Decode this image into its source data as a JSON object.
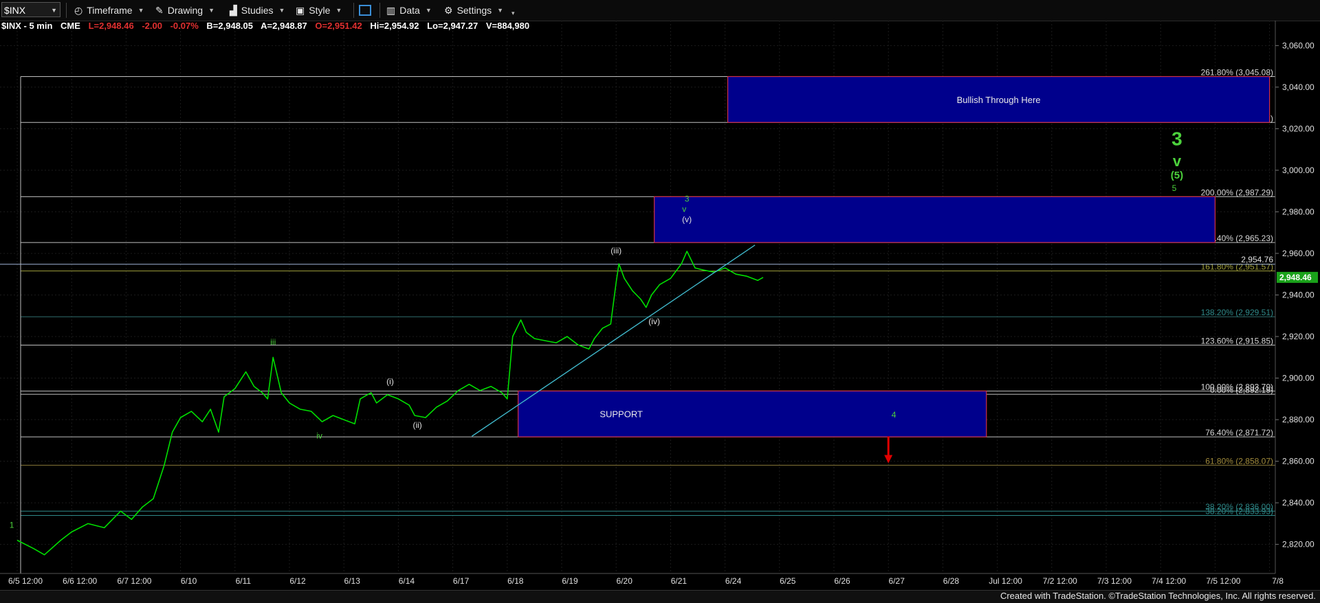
{
  "toolbar": {
    "symbol": "$INX",
    "timeframe": "Timeframe",
    "drawing": "Drawing",
    "studies": "Studies",
    "style": "Style",
    "data": "Data",
    "settings": "Settings"
  },
  "quote": {
    "symbol_interval": "$INX - 5 min",
    "exchange": "CME",
    "last": "L=2,948.46",
    "change": "-2.00",
    "pct": "-0.07%",
    "bid": "B=2,948.05",
    "ask": "A=2,948.87",
    "open": "O=2,951.42",
    "high": "Hi=2,954.92",
    "low": "Lo=2,947.27",
    "volume": "V=884,980"
  },
  "footer": "Created with TradeStation. ©TradeStation Technologies, Inc. All rights reserved.",
  "colors": {
    "background": "#000000",
    "price": "#00e000",
    "box_fill": "#00008c",
    "box_border": "#d0304a",
    "trendline": "#3fb6c9",
    "grid": "#1c1c1c",
    "down_arrow": "#e00000"
  },
  "chart_data": {
    "type": "line",
    "title": "",
    "ylim": [
      2806,
      3072
    ],
    "y_ticks": [
      "3,060.00",
      "3,040.00",
      "3,020.00",
      "3,000.00",
      "2,980.00",
      "2,960.00",
      "2,940.00",
      "2,920.00",
      "2,900.00",
      "2,880.00",
      "2,860.00",
      "2,840.00",
      "2,820.00"
    ],
    "y_tick_values": [
      3060,
      3040,
      3020,
      3000,
      2980,
      2960,
      2940,
      2920,
      2900,
      2880,
      2860,
      2840,
      2820
    ],
    "x_ticks": [
      "6/5 12:00",
      "6/6 12:00",
      "6/7 12:00",
      "6/10",
      "6/11",
      "6/12",
      "6/13",
      "6/14",
      "6/17",
      "6/18",
      "6/19",
      "6/20",
      "6/21",
      "6/24",
      "6/25",
      "6/26",
      "6/27",
      "6/28",
      "Jul 12:00",
      "7/2 12:00",
      "7/3 12:00",
      "7/4 12:00",
      "7/5 12:00",
      "7/8"
    ],
    "last_price": "2,948.46",
    "session_high": "2,954.76",
    "series": [
      {
        "values": [
          [
            0,
            2822
          ],
          [
            0.3,
            2818
          ],
          [
            0.5,
            2815
          ],
          [
            0.8,
            2822
          ],
          [
            1.0,
            2826
          ],
          [
            1.3,
            2830
          ],
          [
            1.6,
            2828
          ],
          [
            1.9,
            2836
          ],
          [
            2.1,
            2832
          ],
          [
            2.3,
            2838
          ],
          [
            2.5,
            2842
          ],
          [
            2.7,
            2858
          ],
          [
            2.85,
            2874
          ],
          [
            3.0,
            2881
          ],
          [
            3.2,
            2884
          ],
          [
            3.4,
            2879
          ],
          [
            3.55,
            2885
          ],
          [
            3.7,
            2874
          ],
          [
            3.8,
            2891
          ],
          [
            4.0,
            2895
          ],
          [
            4.2,
            2903
          ],
          [
            4.35,
            2896
          ],
          [
            4.5,
            2893
          ],
          [
            4.6,
            2890
          ],
          [
            4.7,
            2910
          ],
          [
            4.85,
            2893
          ],
          [
            5.0,
            2888
          ],
          [
            5.2,
            2885
          ],
          [
            5.4,
            2884
          ],
          [
            5.6,
            2879
          ],
          [
            5.8,
            2882
          ],
          [
            6.0,
            2880
          ],
          [
            6.2,
            2878
          ],
          [
            6.3,
            2890
          ],
          [
            6.5,
            2893
          ],
          [
            6.6,
            2888
          ],
          [
            6.8,
            2892
          ],
          [
            7.0,
            2890
          ],
          [
            7.2,
            2887
          ],
          [
            7.3,
            2882
          ],
          [
            7.5,
            2881
          ],
          [
            7.7,
            2886
          ],
          [
            7.9,
            2889
          ],
          [
            8.1,
            2894
          ],
          [
            8.3,
            2897
          ],
          [
            8.5,
            2894
          ],
          [
            8.7,
            2896
          ],
          [
            8.9,
            2893
          ],
          [
            9.0,
            2890
          ],
          [
            9.05,
            2905
          ],
          [
            9.1,
            2920
          ],
          [
            9.25,
            2928
          ],
          [
            9.35,
            2922
          ],
          [
            9.5,
            2919
          ],
          [
            9.7,
            2918
          ],
          [
            9.9,
            2917
          ],
          [
            10.1,
            2920
          ],
          [
            10.3,
            2916
          ],
          [
            10.5,
            2914
          ],
          [
            10.6,
            2919
          ],
          [
            10.75,
            2924
          ],
          [
            10.9,
            2926
          ],
          [
            10.95,
            2936
          ],
          [
            11.0,
            2946
          ],
          [
            11.05,
            2955
          ],
          [
            11.15,
            2948
          ],
          [
            11.3,
            2942
          ],
          [
            11.45,
            2938
          ],
          [
            11.55,
            2934
          ],
          [
            11.65,
            2940
          ],
          [
            11.8,
            2945
          ],
          [
            12.0,
            2948
          ],
          [
            12.2,
            2955
          ],
          [
            12.3,
            2961
          ],
          [
            12.45,
            2953
          ],
          [
            12.6,
            2952
          ],
          [
            12.8,
            2951
          ],
          [
            13.0,
            2953
          ],
          [
            13.2,
            2950
          ],
          [
            13.4,
            2949
          ],
          [
            13.6,
            2947
          ],
          [
            13.7,
            2948.46
          ]
        ]
      }
    ],
    "fib_levels": [
      {
        "label": "261.80% (3,045.08)",
        "value": 3045.08
      },
      {
        "label": "238.20% (3,023.01)",
        "value": 3023.01
      },
      {
        "label": "200.00% (2,987.29)",
        "value": 2987.29
      },
      {
        "label": "176.40% (2,965.23)",
        "value": 2965.23
      },
      {
        "label": "161.80% (2,951.57)",
        "value": 2951.57
      },
      {
        "label": "138.20% (2,929.51)",
        "value": 2929.51
      },
      {
        "label": "123.60% (2,915.85)",
        "value": 2915.85
      },
      {
        "label": "100.00% (2,893.79)",
        "value": 2893.79
      },
      {
        "label": "0.00% (2,892.19)",
        "value": 2892.19
      },
      {
        "label": "76.40% (2,871.72)",
        "value": 2871.72
      },
      {
        "label": "61.80% (2,858.07)",
        "value": 2858.07
      },
      {
        "label": "38.20% (2,836.00)",
        "value": 2836.0
      },
      {
        "label": "38.20% (2,833.93)",
        "value": 2833.93
      }
    ],
    "zones": [
      {
        "label": "Bullish Through Here",
        "x0": 13.05,
        "x1": 23.0,
        "y0": 3023.01,
        "y1": 3045.08
      },
      {
        "label": "",
        "x0": 11.7,
        "x1": 22.0,
        "y0": 2965.23,
        "y1": 2987.29
      },
      {
        "label": "SUPPORT",
        "x0": 9.2,
        "x1": 17.8,
        "y0": 2871.72,
        "y1": 2893.79
      }
    ],
    "wave_labels": [
      {
        "text": "1",
        "x": -0.1,
        "y": 2828
      },
      {
        "text": "iii",
        "x": 4.7,
        "y": 2916
      },
      {
        "text": "iv",
        "x": 5.55,
        "y": 2871
      },
      {
        "text": "(i)",
        "x": 6.85,
        "y": 2897
      },
      {
        "text": "(ii)",
        "x": 7.35,
        "y": 2876
      },
      {
        "text": "(iii)",
        "x": 11.0,
        "y": 2960
      },
      {
        "text": "(iv)",
        "x": 11.7,
        "y": 2926
      },
      {
        "text": "(v)",
        "x": 12.3,
        "y": 2975
      },
      {
        "text": "v",
        "x": 12.25,
        "y": 2980
      },
      {
        "text": "3",
        "x": 12.3,
        "y": 2985
      },
      {
        "text": "4",
        "x": 16.1,
        "y": 2881
      },
      {
        "text": "3",
        "x": 21.3,
        "y": 3012
      },
      {
        "text": "v",
        "x": 21.3,
        "y": 3002
      },
      {
        "text": "(5)",
        "x": 21.3,
        "y": 2996
      },
      {
        "text": "5",
        "x": 21.25,
        "y": 2990
      }
    ],
    "trendline": [
      [
        8.35,
        2872
      ],
      [
        13.55,
        2964
      ]
    ]
  }
}
